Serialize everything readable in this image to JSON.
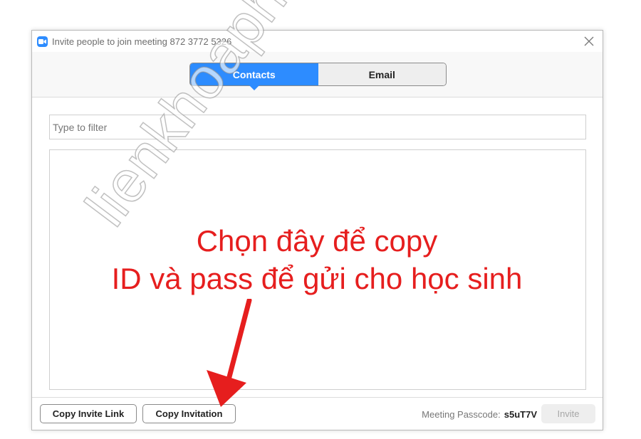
{
  "window": {
    "title": "Invite people to join meeting 872 3772 5326",
    "app_icon": "zoom-video-icon",
    "close_icon": "close-icon"
  },
  "tabs": [
    {
      "label": "Contacts",
      "active": true
    },
    {
      "label": "Email",
      "active": false
    }
  ],
  "filter": {
    "placeholder": "Type to filter",
    "value": ""
  },
  "footer": {
    "copy_invite_link_label": "Copy Invite Link",
    "copy_invitation_label": "Copy Invitation",
    "passcode_label": "Meeting Passcode:",
    "passcode_value": "s5uT7V",
    "invite_label": "Invite"
  },
  "annotation": {
    "line1": "Chọn đây để copy",
    "line2": "ID và pass để gửi cho học sinh",
    "arrow_icon": "red-arrow-icon"
  },
  "watermark": {
    "text": "lienkhoaphat.com"
  },
  "colors": {
    "accent": "#2d8cff",
    "annotation_red": "#e61e1e"
  }
}
